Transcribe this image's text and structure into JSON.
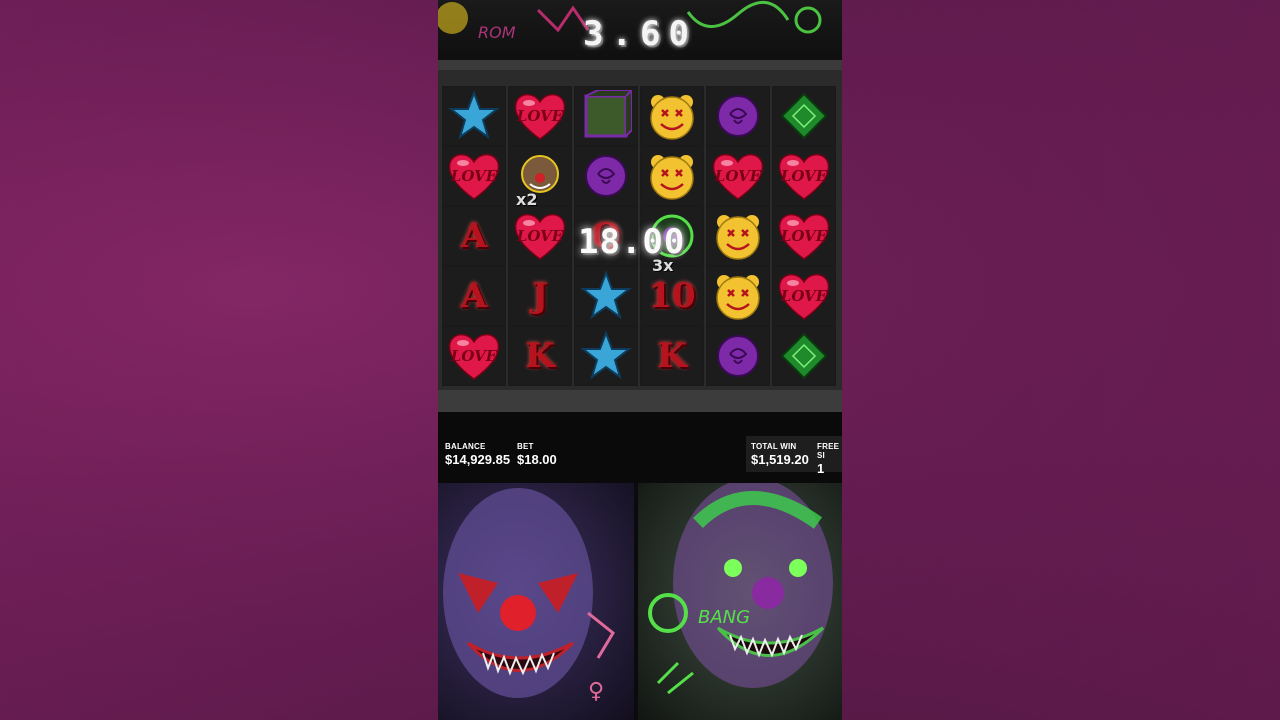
{
  "header": {
    "multiplier": "3.60"
  },
  "grid": {
    "rows": [
      [
        {
          "kind": "star",
          "color": "#3aa6d8"
        },
        {
          "kind": "heart",
          "text": "LOVE"
        },
        {
          "kind": "box"
        },
        {
          "kind": "smiley"
        },
        {
          "kind": "rose",
          "color": "#7e2aa8"
        },
        {
          "kind": "gem",
          "color": "#1e8a2a"
        }
      ],
      [
        {
          "kind": "heart",
          "text": "LOVE"
        },
        {
          "kind": "clown"
        },
        {
          "kind": "rose",
          "color": "#7e2aa8"
        },
        {
          "kind": "smiley"
        },
        {
          "kind": "heart",
          "text": "LOVE"
        },
        {
          "kind": "heart",
          "text": "LOVE"
        }
      ],
      [
        {
          "kind": "letter",
          "text": "A"
        },
        {
          "kind": "heart",
          "text": "LOVE"
        },
        {
          "kind": "letter",
          "text": "Q"
        },
        {
          "kind": "wild"
        },
        {
          "kind": "smiley"
        },
        {
          "kind": "heart",
          "text": "LOVE"
        }
      ],
      [
        {
          "kind": "letter",
          "text": "A"
        },
        {
          "kind": "letter",
          "text": "J"
        },
        {
          "kind": "star",
          "color": "#3aa6d8"
        },
        {
          "kind": "letter",
          "text": "10"
        },
        {
          "kind": "smiley"
        },
        {
          "kind": "heart",
          "text": "LOVE"
        }
      ],
      [
        {
          "kind": "heart",
          "text": "LOVE"
        },
        {
          "kind": "letter",
          "text": "K"
        },
        {
          "kind": "star",
          "color": "#3aa6d8"
        },
        {
          "kind": "letter",
          "text": "K"
        },
        {
          "kind": "rose",
          "color": "#7e2aa8"
        },
        {
          "kind": "gem",
          "color": "#1e8a2a"
        }
      ]
    ],
    "win_amount": "18.00",
    "multiplier_badges": [
      "x2",
      "3x"
    ]
  },
  "stats": {
    "balance_label": "BALANCE",
    "balance_value": "$14,929.85",
    "bet_label": "BET",
    "bet_value": "$18.00",
    "total_win_label": "TOTAL WIN",
    "total_win_value": "$1,519.20",
    "free_spins_label": "FREE SI",
    "free_spins_value": "1"
  },
  "colors": {
    "heart": "#e0184a",
    "smiley": "#f2c230",
    "letter": "#b5141e",
    "background": "#6a1f55"
  }
}
